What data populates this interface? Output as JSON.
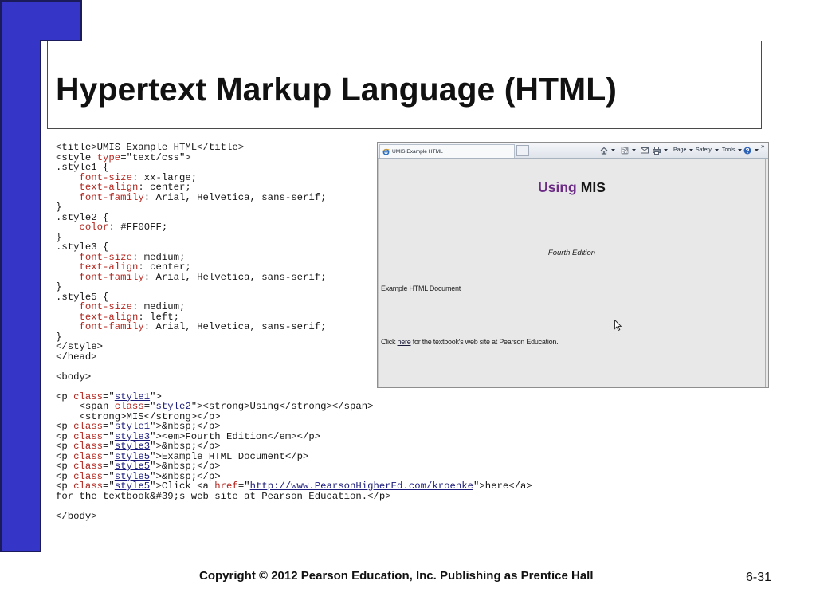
{
  "slide": {
    "title": "Hypertext Markup Language (HTML)",
    "copyright": "Copyright © 2012 Pearson Education, Inc. Publishing as Prentice Hall",
    "page_number": "6-31"
  },
  "colors": {
    "accent_fill": "#3535c8",
    "accent_outline": "#1b1b5c",
    "code_text": "#161616",
    "code_attribute": "#b3261e",
    "code_value": "#1c1c7c",
    "heading_using": "#6b2c86",
    "browser_page_background": "#e8e8e8"
  },
  "code_lines": [
    [
      "<title>UMIS Example HTML</title>"
    ],
    [
      "<style ",
      {
        "t": "type",
        "c": "#b3261e"
      },
      "=\"text/css\">"
    ],
    [
      ".style1 {"
    ],
    [
      "    ",
      {
        "t": "font-size",
        "c": "#b3261e"
      },
      ": xx-large;"
    ],
    [
      "    ",
      {
        "t": "text-align",
        "c": "#b3261e"
      },
      ": center;"
    ],
    [
      "    ",
      {
        "t": "font-family",
        "c": "#b3261e"
      },
      ": Arial, Helvetica, sans-serif;"
    ],
    [
      "}"
    ],
    [
      ".style2 {"
    ],
    [
      "    ",
      {
        "t": "color",
        "c": "#b3261e"
      },
      ": #FF00FF;"
    ],
    [
      "}"
    ],
    [
      ".style3 {"
    ],
    [
      "    ",
      {
        "t": "font-size",
        "c": "#b3261e"
      },
      ": medium;"
    ],
    [
      "    ",
      {
        "t": "text-align",
        "c": "#b3261e"
      },
      ": center;"
    ],
    [
      "    ",
      {
        "t": "font-family",
        "c": "#b3261e"
      },
      ": Arial, Helvetica, sans-serif;"
    ],
    [
      "}"
    ],
    [
      ".style5 {"
    ],
    [
      "    ",
      {
        "t": "font-size",
        "c": "#b3261e"
      },
      ": medium;"
    ],
    [
      "    ",
      {
        "t": "text-align",
        "c": "#b3261e"
      },
      ": left;"
    ],
    [
      "    ",
      {
        "t": "font-family",
        "c": "#b3261e"
      },
      ": Arial, Helvetica, sans-serif;"
    ],
    [
      "}"
    ],
    [
      "</style>"
    ],
    [
      "</head>"
    ],
    [
      ""
    ],
    [
      "<body>"
    ],
    [
      ""
    ],
    [
      "<p ",
      {
        "t": "class",
        "c": "#b3261e"
      },
      "=\"",
      {
        "t": "style1",
        "c": "#1c1c7c",
        "u": true
      },
      "\">"
    ],
    [
      "    <span ",
      {
        "t": "class",
        "c": "#b3261e"
      },
      "=\"",
      {
        "t": "style2",
        "c": "#1c1c7c",
        "u": true
      },
      "\"><strong>Using</strong></span>"
    ],
    [
      "    <strong>MIS</strong></p>"
    ],
    [
      "<p ",
      {
        "t": "class",
        "c": "#b3261e"
      },
      "=\"",
      {
        "t": "style1",
        "c": "#1c1c7c",
        "u": true
      },
      "\">&nbsp;</p>"
    ],
    [
      "<p ",
      {
        "t": "class",
        "c": "#b3261e"
      },
      "=\"",
      {
        "t": "style3",
        "c": "#1c1c7c",
        "u": true
      },
      "\"><em>Fourth Edition</em></p>"
    ],
    [
      "<p ",
      {
        "t": "class",
        "c": "#b3261e"
      },
      "=\"",
      {
        "t": "style3",
        "c": "#1c1c7c",
        "u": true
      },
      "\">&nbsp;</p>"
    ],
    [
      "<p ",
      {
        "t": "class",
        "c": "#b3261e"
      },
      "=\"",
      {
        "t": "style5",
        "c": "#1c1c7c",
        "u": true
      },
      "\">Example HTML Document</p>"
    ],
    [
      "<p ",
      {
        "t": "class",
        "c": "#b3261e"
      },
      "=\"",
      {
        "t": "style5",
        "c": "#1c1c7c",
        "u": true
      },
      "\">&nbsp;</p>"
    ],
    [
      "<p ",
      {
        "t": "class",
        "c": "#b3261e"
      },
      "=\"",
      {
        "t": "style5",
        "c": "#1c1c7c",
        "u": true
      },
      "\">&nbsp;</p>"
    ],
    [
      "<p ",
      {
        "t": "class",
        "c": "#b3261e"
      },
      "=\"",
      {
        "t": "style5",
        "c": "#1c1c7c",
        "u": true
      },
      "\">Click <a ",
      {
        "t": "href",
        "c": "#b3261e"
      },
      "=\"",
      {
        "t": "http://www.PearsonHigherEd.com/kroenke",
        "c": "#1c1c7c",
        "u": true
      },
      "\">here</a>"
    ],
    [
      "for the textbook&#39;s web site at Pearson Education.</p>"
    ],
    [
      ""
    ],
    [
      "</body>"
    ]
  ],
  "browser": {
    "tab_title": "UMIS Example HTML",
    "toolbar": {
      "icons": [
        "ie-icon",
        "home-icon",
        "feeds-icon",
        "mail-icon",
        "print-icon",
        "help-icon",
        "dropdown-arrow-icon"
      ],
      "page_label": "Page",
      "safety_label": "Safety",
      "tools_label": "Tools",
      "overflow_label": "»"
    },
    "page": {
      "heading_using": "Using",
      "heading_mis": "MIS",
      "subtitle": "Fourth Edition",
      "paragraph": "Example HTML Document",
      "click_prefix": "Click ",
      "link_text": "here",
      "click_suffix": " for the textbook's web site at Pearson Education."
    }
  }
}
